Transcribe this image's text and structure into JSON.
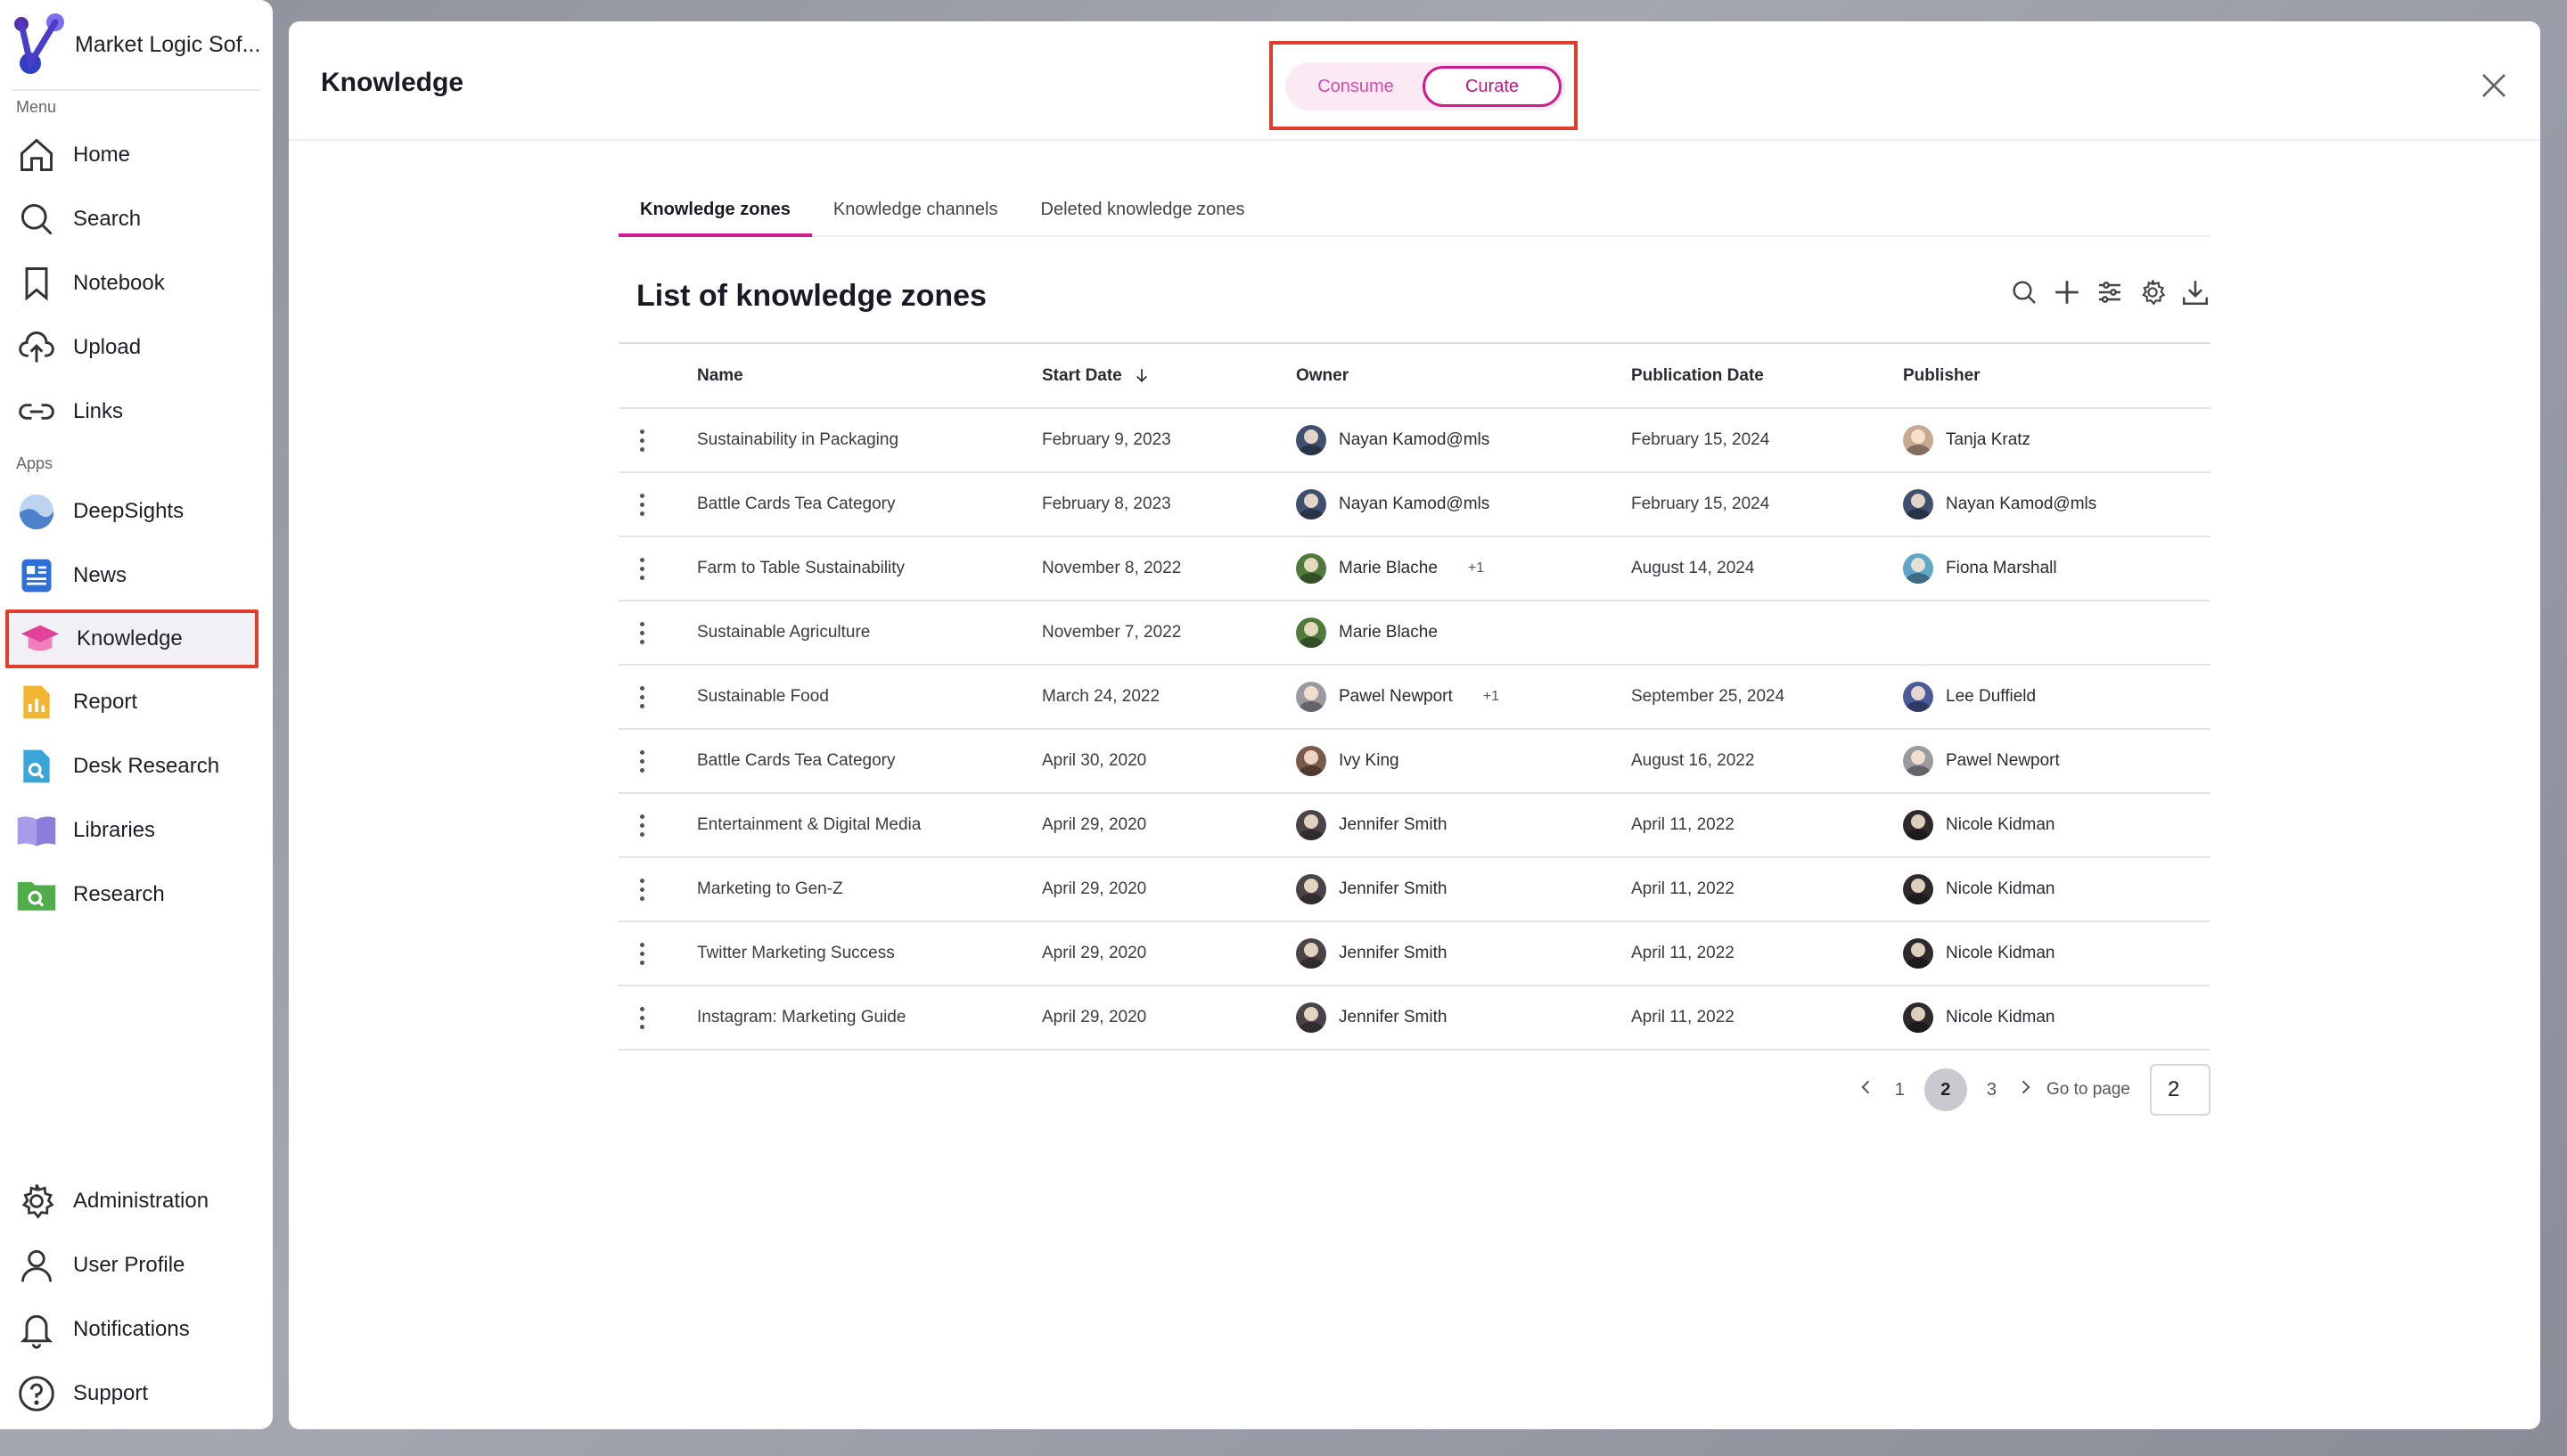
{
  "brand": {
    "name": "Market Logic Sof..."
  },
  "sidebar": {
    "menu_label": "Menu",
    "apps_label": "Apps",
    "menu": [
      {
        "label": "Home",
        "icon": "home-icon"
      },
      {
        "label": "Search",
        "icon": "search-icon"
      },
      {
        "label": "Notebook",
        "icon": "bookmark-icon"
      },
      {
        "label": "Upload",
        "icon": "upload-cloud-icon"
      },
      {
        "label": "Links",
        "icon": "link-icon"
      }
    ],
    "apps": [
      {
        "label": "DeepSights",
        "icon": "deepsights-icon"
      },
      {
        "label": "News",
        "icon": "news-icon"
      },
      {
        "label": "Knowledge",
        "icon": "knowledge-icon",
        "selected": true
      },
      {
        "label": "Report",
        "icon": "report-icon"
      },
      {
        "label": "Desk Research",
        "icon": "desk-research-icon"
      },
      {
        "label": "Libraries",
        "icon": "libraries-icon"
      },
      {
        "label": "Research",
        "icon": "research-icon"
      }
    ],
    "bottom": [
      {
        "label": "Administration",
        "icon": "gear-icon"
      },
      {
        "label": "User Profile",
        "icon": "user-icon"
      },
      {
        "label": "Notifications",
        "icon": "bell-icon"
      },
      {
        "label": "Support",
        "icon": "help-icon"
      }
    ]
  },
  "panel": {
    "title": "Knowledge",
    "toggle": {
      "consume": "Consume",
      "curate": "Curate",
      "active": "curate"
    }
  },
  "tabs": [
    {
      "label": "Knowledge zones",
      "active": true
    },
    {
      "label": "Knowledge channels",
      "active": false
    },
    {
      "label": "Deleted knowledge zones",
      "active": false
    }
  ],
  "list": {
    "title": "List of knowledge zones",
    "columns": {
      "name": "Name",
      "start": "Start Date",
      "owner": "Owner",
      "publication": "Publication Date",
      "publisher": "Publisher"
    },
    "rows": [
      {
        "name": "Sustainability in Packaging",
        "start": "February 9, 2023",
        "owner": "Nayan Kamod@mls",
        "owner_extra": "",
        "publication": "February 15, 2024",
        "publisher": "Tanja Kratz"
      },
      {
        "name": "Battle Cards Tea Category",
        "start": "February 8, 2023",
        "owner": "Nayan Kamod@mls",
        "owner_extra": "",
        "publication": "February 15, 2024",
        "publisher": "Nayan Kamod@mls"
      },
      {
        "name": "Farm to Table Sustainability",
        "start": "November 8, 2022",
        "owner": "Marie Blache",
        "owner_extra": "+1",
        "publication": "August 14, 2024",
        "publisher": "Fiona Marshall"
      },
      {
        "name": "Sustainable Agriculture",
        "start": "November 7, 2022",
        "owner": "Marie Blache",
        "owner_extra": "",
        "publication": "",
        "publisher": ""
      },
      {
        "name": "Sustainable Food",
        "start": "March 24, 2022",
        "owner": "Pawel Newport",
        "owner_extra": "+1",
        "publication": "September 25, 2024",
        "publisher": "Lee Duffield"
      },
      {
        "name": "Battle Cards Tea Category",
        "start": "April 30, 2020",
        "owner": "Ivy King",
        "owner_extra": "",
        "publication": "August 16, 2022",
        "publisher": "Pawel Newport"
      },
      {
        "name": "Entertainment & Digital Media",
        "start": "April 29, 2020",
        "owner": "Jennifer Smith",
        "owner_extra": "",
        "publication": "April 11, 2022",
        "publisher": "Nicole Kidman"
      },
      {
        "name": "Marketing to Gen-Z",
        "start": "April 29, 2020",
        "owner": "Jennifer Smith",
        "owner_extra": "",
        "publication": "April 11, 2022",
        "publisher": "Nicole Kidman"
      },
      {
        "name": "Twitter Marketing Success",
        "start": "April 29, 2020",
        "owner": "Jennifer Smith",
        "owner_extra": "",
        "publication": "April 11, 2022",
        "publisher": "Nicole Kidman"
      },
      {
        "name": "Instagram: Marketing Guide",
        "start": "April 29, 2020",
        "owner": "Jennifer Smith",
        "owner_extra": "",
        "publication": "April 11, 2022",
        "publisher": "Nicole Kidman"
      }
    ]
  },
  "avatar_colors": {
    "Nayan Kamod@mls": "#3f4f6e",
    "Tanja Kratz": "#c9a892",
    "Marie Blache": "#4f7a3c",
    "Fiona Marshall": "#5fa6c9",
    "Pawel Newport": "#9a9aa0",
    "Lee Duffield": "#4a5a9a",
    "Ivy King": "#7a5a4a",
    "Jennifer Smith": "#4a4448",
    "Nicole Kidman": "#2e2a2c"
  },
  "pager": {
    "pages": [
      "1",
      "2",
      "3"
    ],
    "current": "2",
    "goto_label": "Go to page",
    "goto_value": "2"
  },
  "colors": {
    "accent": "#d01d8d",
    "highlight": "#e03c2c"
  }
}
